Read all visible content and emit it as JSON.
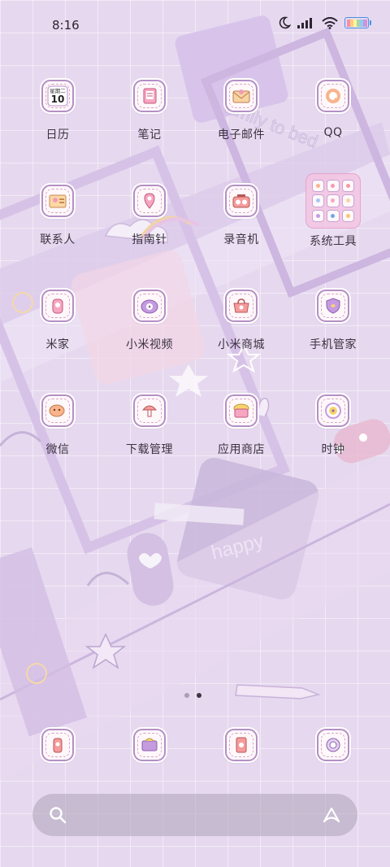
{
  "status_bar": {
    "time": "8:16",
    "icons": [
      "moon-icon",
      "signal-icon",
      "wifi-icon",
      "battery-icon"
    ]
  },
  "calendar_icon": {
    "weekday": "星期二",
    "day": "10"
  },
  "apps": [
    {
      "label": "日历",
      "icon": "calendar-icon"
    },
    {
      "label": "笔记",
      "icon": "notes-icon"
    },
    {
      "label": "电子邮件",
      "icon": "email-icon"
    },
    {
      "label": "QQ",
      "icon": "qq-icon"
    },
    {
      "label": "联系人",
      "icon": "contacts-icon"
    },
    {
      "label": "指南针",
      "icon": "compass-icon"
    },
    {
      "label": "录音机",
      "icon": "recorder-icon"
    },
    {
      "label": "系统工具",
      "icon": "folder-icon"
    },
    {
      "label": "米家",
      "icon": "mijia-icon"
    },
    {
      "label": "小米视频",
      "icon": "video-icon"
    },
    {
      "label": "小米商城",
      "icon": "mall-icon"
    },
    {
      "label": "手机管家",
      "icon": "security-icon"
    },
    {
      "label": "微信",
      "icon": "wechat-icon"
    },
    {
      "label": "下载管理",
      "icon": "download-icon"
    },
    {
      "label": "应用商店",
      "icon": "app-store-icon"
    },
    {
      "label": "时钟",
      "icon": "clock-icon"
    }
  ],
  "dock": [
    "phone-icon",
    "messages-icon",
    "browser-icon",
    "camera-icon"
  ],
  "wallpaper_text": [
    "Emily to bed",
    "happy"
  ],
  "pager": {
    "pages": 2,
    "current": 2
  },
  "colors": {
    "accent": "#b48fc4",
    "background": "#e6d9ef",
    "battery": "#4a90e2"
  }
}
